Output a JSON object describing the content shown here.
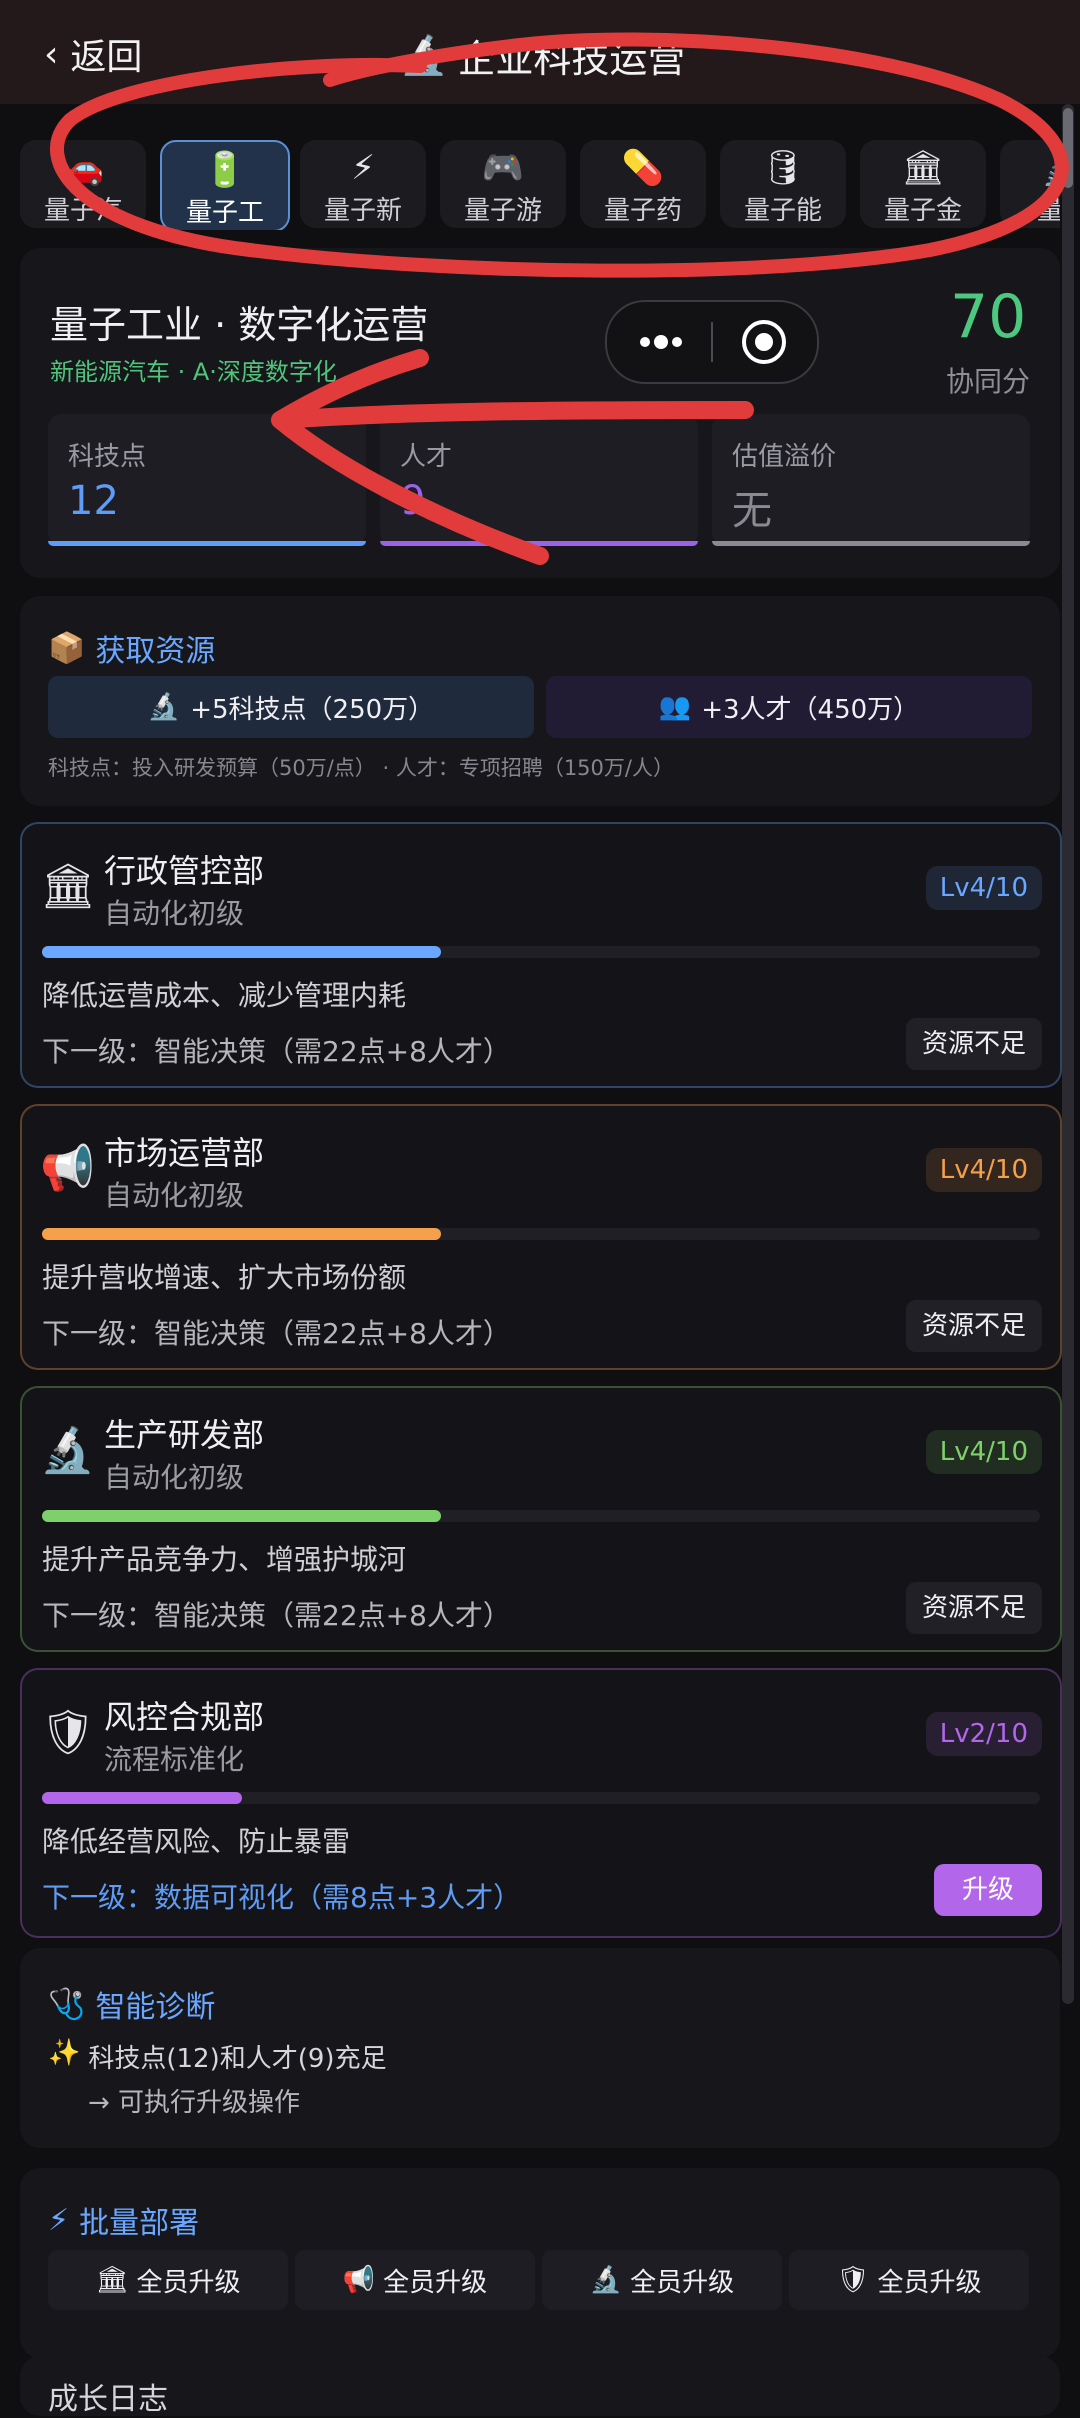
{
  "header": {
    "back_label": "返回",
    "title": "企业科技运营"
  },
  "tabs": [
    {
      "label": "量子汽",
      "icon": "car-icon",
      "glyph": "🚗"
    },
    {
      "label": "量子工",
      "icon": "battery-icon",
      "glyph": "🔋",
      "active": true
    },
    {
      "label": "量子新",
      "icon": "lightning-icon",
      "glyph": "⚡"
    },
    {
      "label": "量子游",
      "icon": "gamepad-icon",
      "glyph": "🎮"
    },
    {
      "label": "量子药",
      "icon": "pill-icon",
      "glyph": "💊"
    },
    {
      "label": "量子能",
      "icon": "barrel-icon",
      "glyph": "🛢"
    },
    {
      "label": "量子金",
      "icon": "bank-icon",
      "glyph": "🏛"
    },
    {
      "label": "量子",
      "icon": "microscope-icon",
      "glyph": "🔬"
    }
  ],
  "overview": {
    "title": "量子工业 · 数字化运营",
    "subtitle": "新能源汽车 · A·深度数字化",
    "score": "70",
    "score_label": "协同分",
    "stats": [
      {
        "label": "科技点",
        "value": "12",
        "color": "#5f9cf5"
      },
      {
        "label": "人才",
        "value": "9",
        "color": "#9b62e6"
      },
      {
        "label": "估值溢价",
        "value": "无",
        "color": "#8a8a92"
      }
    ]
  },
  "resources": {
    "title": "获取资源",
    "tech_button": "+5科技点（250万）",
    "talent_button": "+3人才（450万）",
    "note": "科技点：投入研发预算（50万/点） · 人才：专项招聘（150万/人）"
  },
  "departments": [
    {
      "name": "行政管控部",
      "stage": "自动化初级",
      "level": "Lv4/10",
      "progress": 0.4,
      "color": "#6aa7ff",
      "desc": "降低运营成本、减少管理内耗",
      "next": "下一级：智能决策（需22点+8人才）",
      "action": "资源不足",
      "icon": "bank-icon",
      "glyph": "🏛"
    },
    {
      "name": "市场运营部",
      "stage": "自动化初级",
      "level": "Lv4/10",
      "progress": 0.4,
      "color": "#f5a04a",
      "desc": "提升营收增速、扩大市场份额",
      "next": "下一级：智能决策（需22点+8人才）",
      "action": "资源不足",
      "icon": "megaphone-icon",
      "glyph": "📢"
    },
    {
      "name": "生产研发部",
      "stage": "自动化初级",
      "level": "Lv4/10",
      "progress": 0.4,
      "color": "#7ed16a",
      "desc": "提升产品竞争力、增强护城河",
      "next": "下一级：智能决策（需22点+8人才）",
      "action": "资源不足",
      "icon": "microscope-icon",
      "glyph": "🔬"
    },
    {
      "name": "风控合规部",
      "stage": "流程标准化",
      "level": "Lv2/10",
      "progress": 0.2,
      "color": "#b267ea",
      "desc": "降低经营风险、防止暴雷",
      "next": "下一级：数据可视化（需8点+3人才）",
      "action": "升级",
      "icon": "shield-icon",
      "glyph": "🛡"
    }
  ],
  "diagnosis": {
    "title": "智能诊断",
    "line1": "科技点(12)和人才(9)充足",
    "line2": "→ 可执行升级操作"
  },
  "batch": {
    "title": "批量部署",
    "buttons": [
      {
        "label": "全员升级",
        "glyph": "🏛",
        "icon": "bank-icon"
      },
      {
        "label": "全员升级",
        "glyph": "📢",
        "icon": "megaphone-icon"
      },
      {
        "label": "全员升级",
        "glyph": "🔬",
        "icon": "microscope-icon"
      },
      {
        "label": "全员升级",
        "glyph": "🛡",
        "icon": "shield-icon"
      }
    ]
  },
  "growth": {
    "title": "成长日志"
  },
  "colors": {
    "accent": "#6aa7ff",
    "green": "#4cc97f",
    "purple": "#b267ea",
    "annotation_red": "#e23b3b"
  }
}
